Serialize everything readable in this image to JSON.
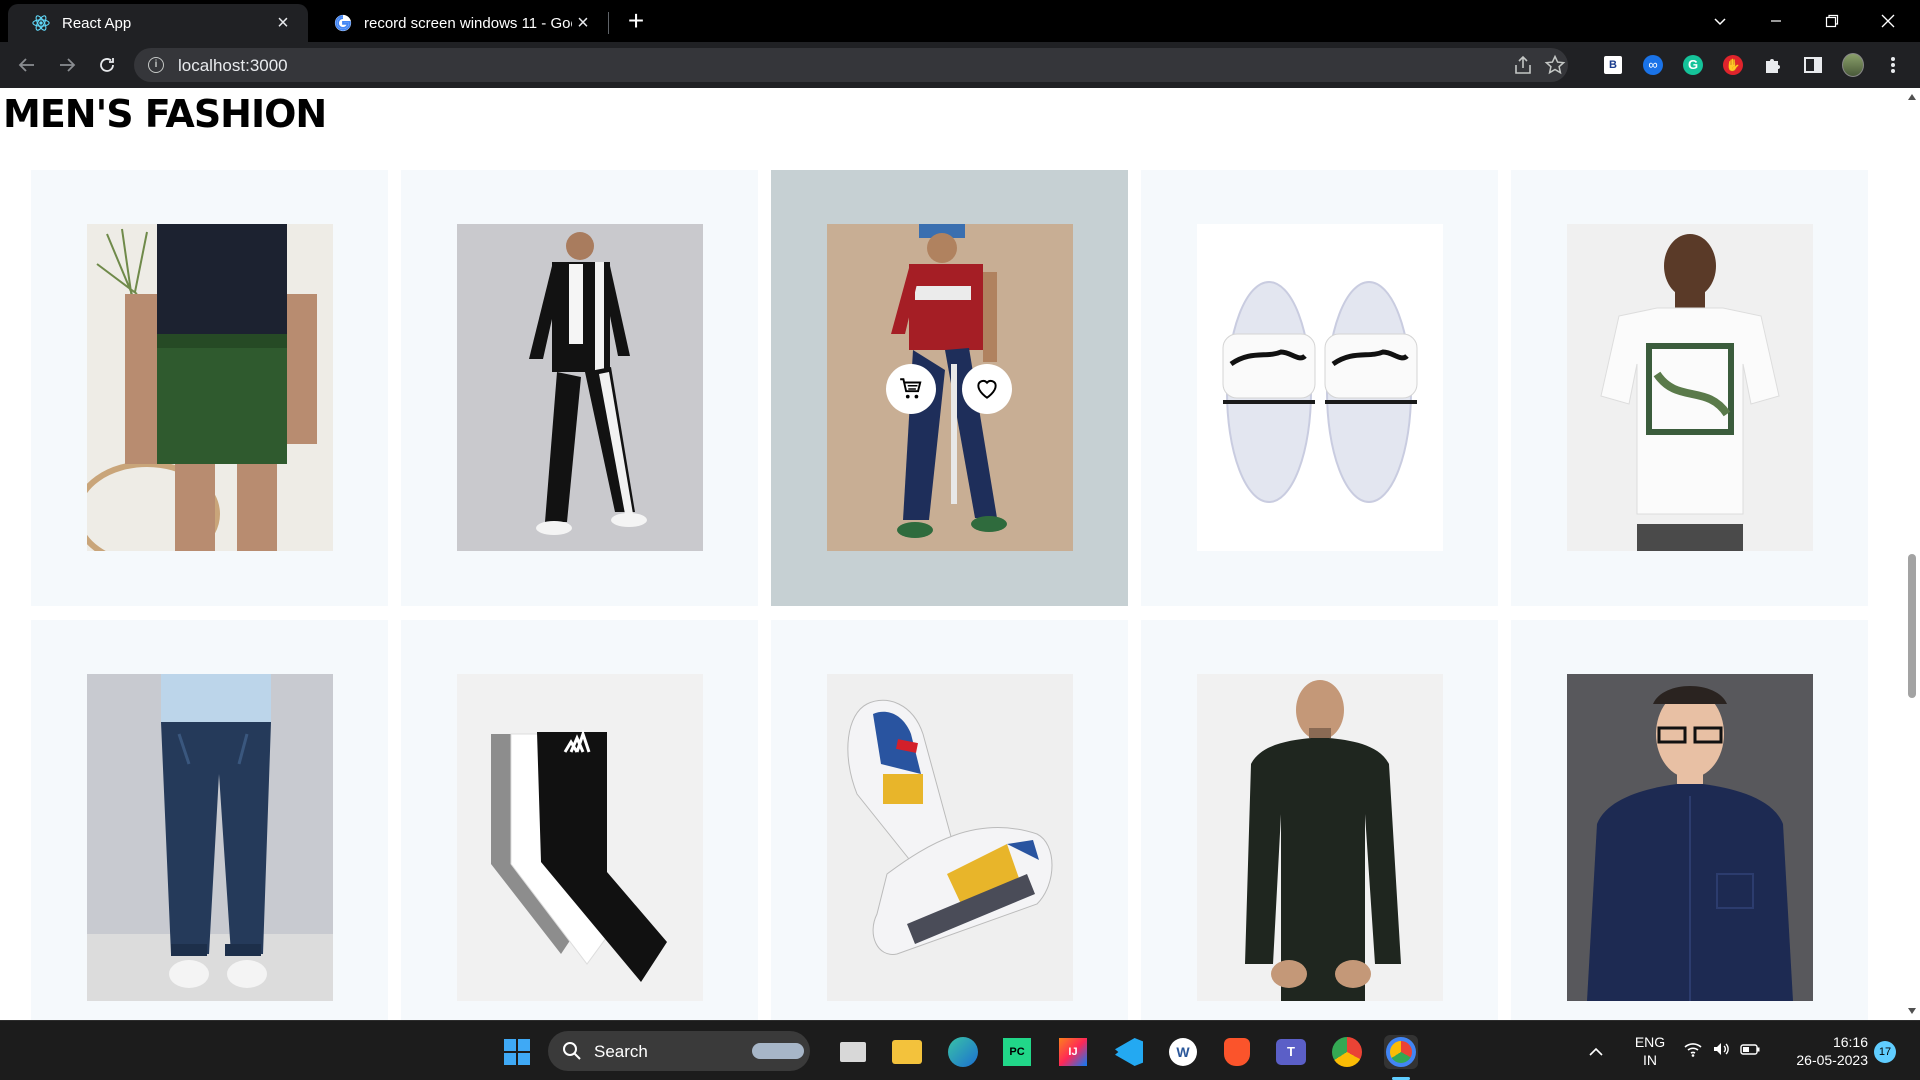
{
  "browser": {
    "tabs": [
      {
        "title": "React App",
        "icon": "react-icon",
        "active": true
      },
      {
        "title": "record screen windows 11 - Goo",
        "icon": "google-icon",
        "active": false
      }
    ],
    "url": "localhost:3000"
  },
  "page": {
    "heading": "MEN'S FASHION",
    "products": [
      {
        "name": "green shorts",
        "icon": "green-shorts-photo"
      },
      {
        "name": "black track suit",
        "icon": "black-tracksuit-photo"
      },
      {
        "name": "red tee and navy joggers",
        "icon": "red-tee-joggers-photo",
        "hovered": true
      },
      {
        "name": "puma slides",
        "icon": "white-slides-photo"
      },
      {
        "name": "puma white tee",
        "icon": "white-tshirt-photo"
      },
      {
        "name": "blue jeans",
        "icon": "blue-jeans-photo"
      },
      {
        "name": "adidas socks",
        "icon": "socks-photo"
      },
      {
        "name": "sneakers",
        "icon": "sneakers-photo"
      },
      {
        "name": "black turtleneck",
        "icon": "black-sweater-photo"
      },
      {
        "name": "navy shirt",
        "icon": "navy-shirt-photo"
      }
    ],
    "card_actions": {
      "cart": "cart-icon",
      "wishlist": "heart-icon"
    }
  },
  "taskbar": {
    "search_label": "Search",
    "lang_line1": "ENG",
    "lang_line2": "IN",
    "time": "16:16",
    "date": "26-05-2023",
    "notification_count": "17"
  },
  "colors": {
    "card_bg": "#f5f9fc",
    "card_hover_bg": "#c6d0d3",
    "tabbar": "#000000",
    "toolbar": "#202124"
  }
}
